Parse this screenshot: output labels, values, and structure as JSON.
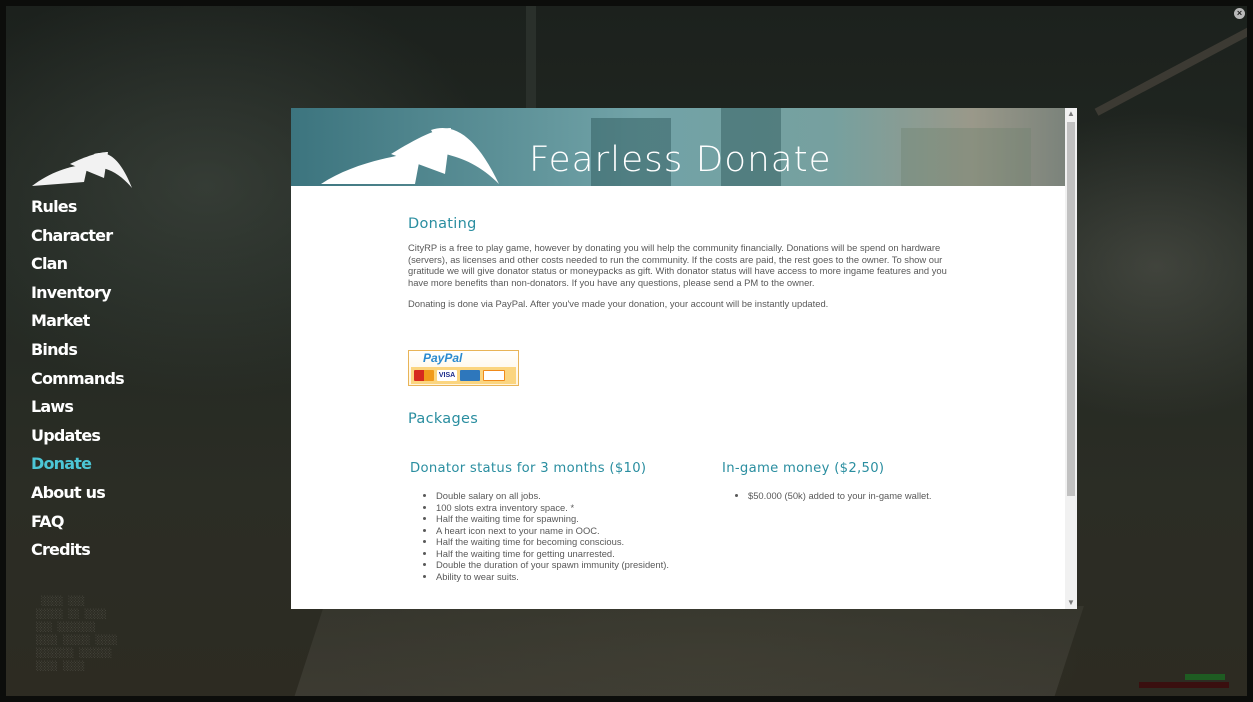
{
  "window": {
    "close_glyph": "×"
  },
  "menu": {
    "items": [
      {
        "label": "Rules",
        "name": "rules"
      },
      {
        "label": "Character",
        "name": "character"
      },
      {
        "label": "Clan",
        "name": "clan"
      },
      {
        "label": "Inventory",
        "name": "inventory"
      },
      {
        "label": "Market",
        "name": "market"
      },
      {
        "label": "Binds",
        "name": "binds"
      },
      {
        "label": "Commands",
        "name": "commands"
      },
      {
        "label": "Laws",
        "name": "laws"
      },
      {
        "label": "Updates",
        "name": "updates"
      },
      {
        "label": "Donate",
        "name": "donate",
        "active": true
      },
      {
        "label": "About us",
        "name": "about-us"
      },
      {
        "label": "FAQ",
        "name": "faq"
      },
      {
        "label": "Credits",
        "name": "credits"
      }
    ],
    "active_color": "#4cc6d6"
  },
  "banner": {
    "title": "Fearless Donate"
  },
  "donating": {
    "heading": "Donating",
    "paragraph1": "CityRP is a free to play game, however by donating you will help the community financially. Donations will be spend on hardware (servers), as licenses and other costs needed to run the community. If the costs are paid, the rest goes to the owner. To show our gratitude we will give donator status or moneypacks as gift. With donator status will have access to more ingame features and you have more benefits than non-donators. If you have any questions, please send a PM to the owner.",
    "paragraph2": "Donating is done via PayPal. After you've made your donation, your account will be instantly updated.",
    "paypal": {
      "word_pay": "Pay",
      "word_pal": "Pal",
      "card_visa": "VISA"
    }
  },
  "packages": {
    "heading": "Packages",
    "donator": {
      "title": "Donator status for 3 months ($10)",
      "items": [
        "Double salary on all jobs.",
        "100 slots extra inventory space. *",
        "Half the waiting time for spawning.",
        "A heart icon next to your name in OOC.",
        "Half the waiting time for becoming conscious.",
        "Half the waiting time for getting unarrested.",
        "Double the duration of your spawn immunity (president).",
        "Ability to wear suits."
      ]
    },
    "money": {
      "title": "In-game money ($2,50)",
      "items": [
        "$50.000 (50k) added to your in-game wallet."
      ]
    }
  },
  "accent_color": "#2a8ea0"
}
